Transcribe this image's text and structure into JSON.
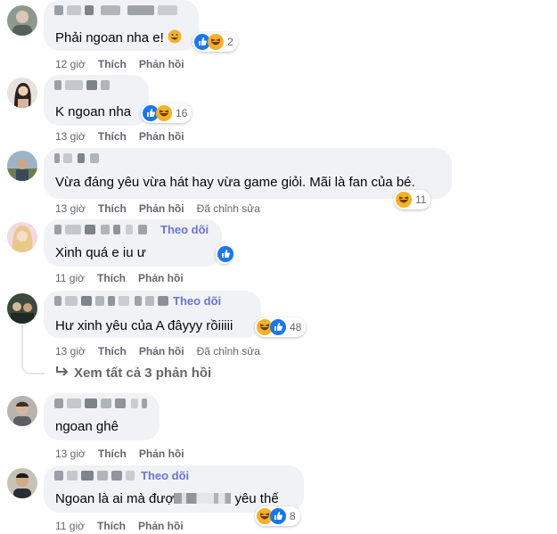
{
  "colors": {
    "bubble": "#f0f2f5",
    "meta": "#65676b",
    "follow": "#6a73d6",
    "like": "#1877f2",
    "haha": "#f7b125"
  },
  "labels": {
    "like": "Thích",
    "reply": "Phản hồi",
    "edited": "Đã chỉnh sửa",
    "follow": "Theo dõi"
  },
  "comments": [
    {
      "text": "Phải ngoan nha e!",
      "time": "12 giờ",
      "reactions": [
        "like-icon",
        "haha-icon"
      ],
      "count": "2"
    },
    {
      "text": "K ngoan nha",
      "time": "13 giờ",
      "reactions": [
        "like-icon",
        "haha-icon"
      ],
      "count": "16"
    },
    {
      "text": "Vừa đáng yêu vừa hát hay vừa game giỏi. Mãi là fan của bé.",
      "time": "13 giờ",
      "edited": true,
      "reactions": [
        "haha-icon"
      ],
      "count": "11"
    },
    {
      "text": "Xinh quá e iu ư",
      "time": "11 giờ",
      "follow": true,
      "reactions": [
        "like-icon"
      ],
      "count": ""
    },
    {
      "text": "Hư xinh yêu của A đâyyy rồiiiii",
      "time": "13 giờ",
      "follow": true,
      "edited": true,
      "reactions": [
        "haha-icon",
        "like-icon"
      ],
      "count": "48"
    },
    {
      "text": "ngoan ghê",
      "time": "13 giờ",
      "reactions": [],
      "count": ""
    },
    {
      "text_before": "Ngoan là ai mà đượ",
      "text_after": "yêu thế",
      "time": "11 giờ",
      "follow": true,
      "reactions": [
        "haha-icon",
        "like-icon"
      ],
      "count": "8"
    }
  ],
  "view_replies": "Xem tất cả 3 phản hồi"
}
